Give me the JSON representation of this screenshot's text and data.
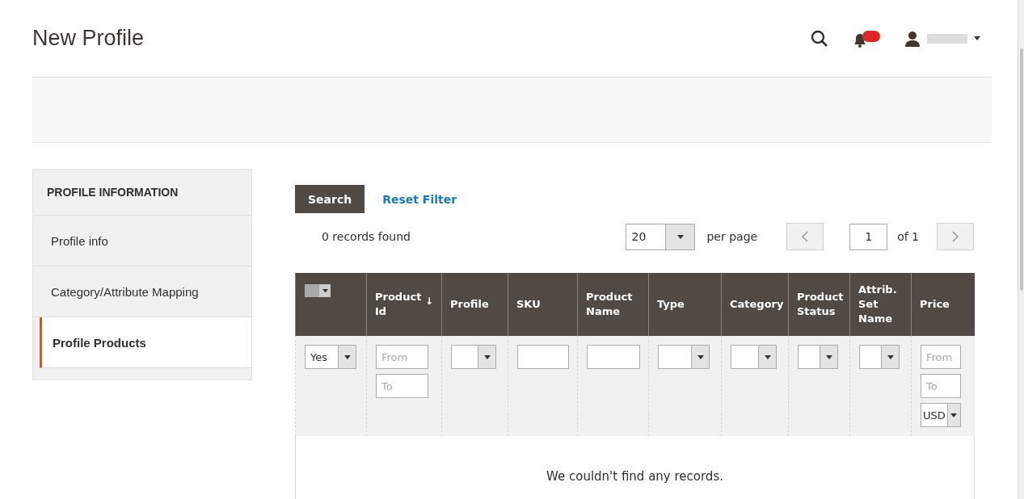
{
  "header": {
    "title": "New Profile",
    "notifications": {
      "badge": true
    }
  },
  "sidebar": {
    "title": "PROFILE INFORMATION",
    "items": [
      {
        "label": "Profile info",
        "selected": false
      },
      {
        "label": "Category/Attribute Mapping",
        "selected": false
      },
      {
        "label": "Profile Products",
        "selected": true
      }
    ]
  },
  "actions": {
    "search": "Search",
    "reset": "Reset Filter"
  },
  "pager": {
    "records": "0 records found",
    "per_page_value": "20",
    "per_page_label": "per page",
    "page": "1",
    "of": "of 1"
  },
  "table": {
    "columns": [
      {
        "kind": "mass"
      },
      {
        "kind": "text",
        "label": "Product Id",
        "sort_mark": "↓"
      },
      {
        "kind": "text",
        "label": "Profile"
      },
      {
        "kind": "text",
        "label": "SKU"
      },
      {
        "kind": "text",
        "label": "Product Name"
      },
      {
        "kind": "text",
        "label": "Type"
      },
      {
        "kind": "text",
        "label": "Category"
      },
      {
        "kind": "text",
        "label": "Product Status"
      },
      {
        "kind": "text",
        "label": "Attrib. Set Name"
      },
      {
        "kind": "text",
        "label": "Price"
      }
    ],
    "filters": [
      {
        "kind": "select",
        "value": "Yes"
      },
      {
        "kind": "range",
        "placeholders": [
          "From",
          "To"
        ]
      },
      {
        "kind": "select"
      },
      {
        "kind": "text"
      },
      {
        "kind": "text"
      },
      {
        "kind": "select"
      },
      {
        "kind": "select"
      },
      {
        "kind": "select"
      },
      {
        "kind": "select"
      },
      {
        "kind": "range",
        "placeholders": [
          "From",
          "To"
        ],
        "currency": "USD"
      }
    ],
    "empty": "We couldn't find any records."
  }
}
